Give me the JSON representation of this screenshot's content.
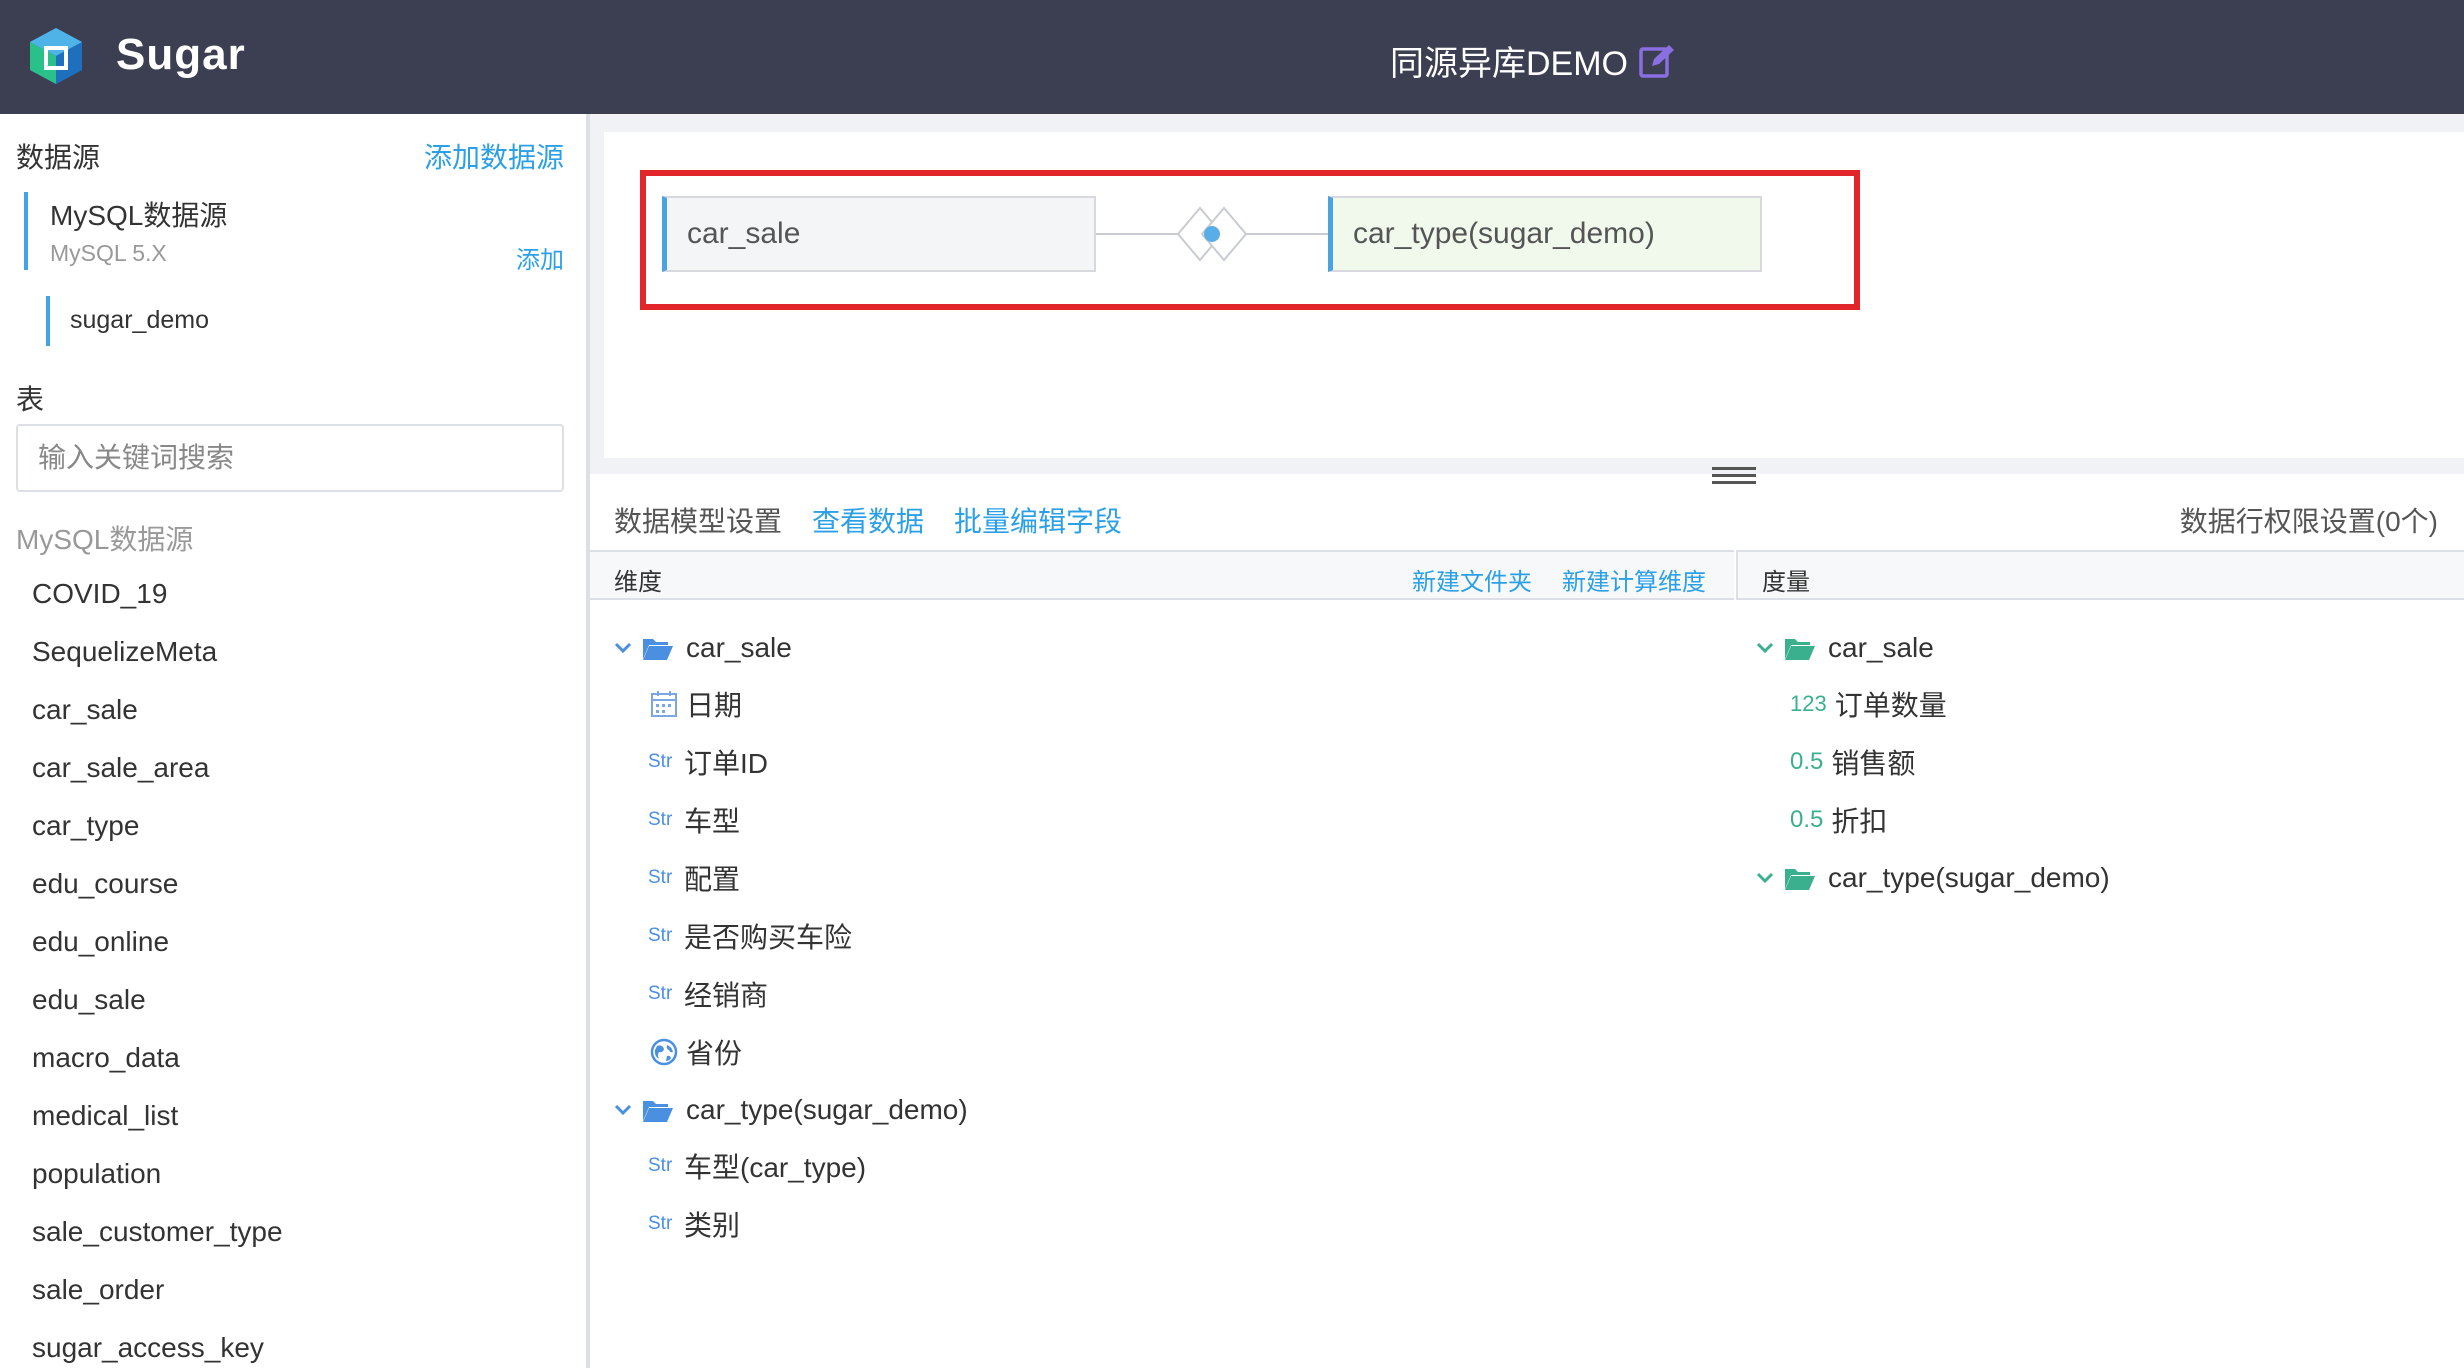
{
  "header": {
    "brand": "Sugar",
    "title": "同源异库DEMO",
    "colors": {
      "bg": "#3c3f51",
      "accent": "#2ca0e6",
      "edit_icon": "#8a6fe0"
    }
  },
  "sidebar": {
    "datasource_heading": "数据源",
    "add_datasource": "添加数据源",
    "datasource_name": "MySQL数据源",
    "datasource_version": "MySQL 5.X",
    "add": "添加",
    "database": "sugar_demo",
    "table_heading": "表",
    "search_placeholder": "输入关键词搜索",
    "group_label": "MySQL数据源",
    "tables": [
      "COVID_19",
      "SequelizeMeta",
      "car_sale",
      "car_sale_area",
      "car_type",
      "edu_course",
      "edu_online",
      "edu_sale",
      "macro_data",
      "medical_list",
      "population",
      "sale_customer_type",
      "sale_order",
      "sugar_access_key"
    ]
  },
  "model": {
    "left_table": "car_sale",
    "right_table": "car_type(sugar_demo)"
  },
  "tabs": {
    "settings": "数据模型设置",
    "view_data": "查看数据",
    "batch_edit": "批量编辑字段",
    "row_permission": "数据行权限设置(0个)"
  },
  "dimensions": {
    "title": "维度",
    "new_folder": "新建文件夹",
    "new_calc": "新建计算维度",
    "groups": [
      {
        "name": "car_sale",
        "fields": [
          {
            "type": "date",
            "label": "日期"
          },
          {
            "type": "Str",
            "label": "订单ID"
          },
          {
            "type": "Str",
            "label": "车型"
          },
          {
            "type": "Str",
            "label": "配置"
          },
          {
            "type": "Str",
            "label": "是否购买车险"
          },
          {
            "type": "Str",
            "label": "经销商"
          },
          {
            "type": "geo",
            "label": "省份"
          }
        ]
      },
      {
        "name": "car_type(sugar_demo)",
        "fields": [
          {
            "type": "Str",
            "label": "车型(car_type)"
          },
          {
            "type": "Str",
            "label": "类别"
          }
        ]
      }
    ]
  },
  "measures": {
    "title": "度量",
    "groups": [
      {
        "name": "car_sale",
        "fields": [
          {
            "type": "123",
            "label": "订单数量"
          },
          {
            "type": "0.5",
            "label": "销售额"
          },
          {
            "type": "0.5",
            "label": "折扣"
          }
        ]
      },
      {
        "name": "car_type(sugar_demo)",
        "fields": []
      }
    ]
  }
}
